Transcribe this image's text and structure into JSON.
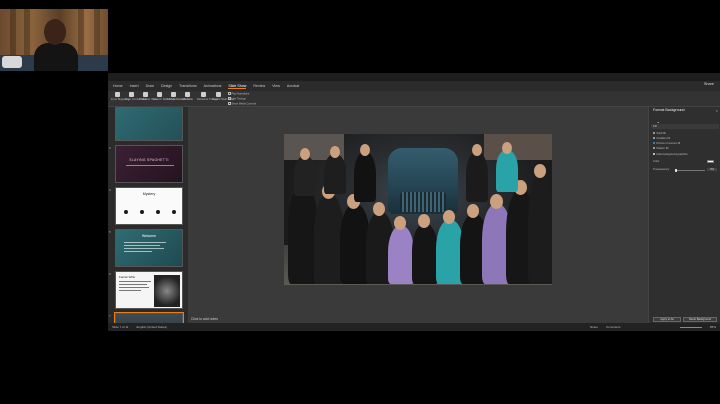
{
  "app": {
    "tabs": [
      "Home",
      "Insert",
      "Draw",
      "Design",
      "Transitions",
      "Animations",
      "Slide Show",
      "Review",
      "View",
      "Acrobat"
    ],
    "active_tab": "Slide Show",
    "share_label": "Share"
  },
  "ribbon": {
    "buttons": [
      "From Beginning",
      "From Current Slide",
      "Presenter View",
      "Custom Slide Show",
      "Set Up Slide Show",
      "Hide Slide",
      "Rehearse Timings",
      "Record Slide Show"
    ],
    "checks": [
      "Play Narrations",
      "Use Timings",
      "Show Media Controls"
    ]
  },
  "thumbnails": [
    {
      "number": "2",
      "title": ""
    },
    {
      "number": "3",
      "title": "SLAYING SPAGHETTI"
    },
    {
      "number": "4",
      "title": "Mystery"
    },
    {
      "number": "5",
      "title": "Welcome"
    },
    {
      "number": "6",
      "title": "Farrah Wills"
    },
    {
      "number": "7",
      "title": ""
    }
  ],
  "canvas": {
    "notes_placeholder": "Click to add notes"
  },
  "format_pane": {
    "title": "Format Background",
    "section": "Fill",
    "options": [
      {
        "label": "Solid fill",
        "selected": false
      },
      {
        "label": "Gradient fill",
        "selected": false
      },
      {
        "label": "Picture or texture fill",
        "selected": true
      },
      {
        "label": "Pattern fill",
        "selected": false
      }
    ],
    "hide_label": "Hide background graphics",
    "color_label": "Color",
    "transparency_label": "Transparency",
    "transparency_value": "0%",
    "apply_all_label": "Apply to All",
    "reset_label": "Reset Background"
  },
  "status": {
    "slide_info": "Slide 7 of 11",
    "language": "English (United States)",
    "notes": "Notes",
    "comments": "Comments",
    "zoom": "85%"
  },
  "colors": {
    "accent": "#e67e22",
    "canvas": "#3a3a3a",
    "panel": "#2b2b2b"
  }
}
